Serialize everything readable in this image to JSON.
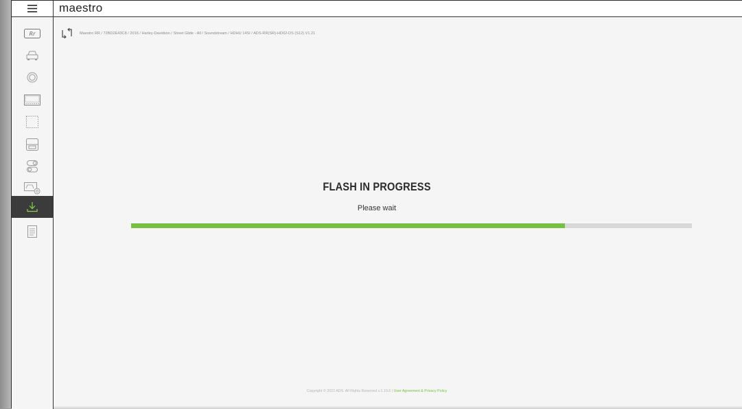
{
  "app": {
    "logo": "maestro"
  },
  "sidebar": {
    "items": [
      {
        "icon": "rr-logo-icon"
      },
      {
        "icon": "car-icon"
      },
      {
        "icon": "steering-wheel-icon"
      },
      {
        "icon": "radio-display-icon"
      },
      {
        "icon": "dashed-panel-icon"
      },
      {
        "icon": "instrument-panel-icon"
      },
      {
        "icon": "toggle-settings-icon"
      },
      {
        "icon": "vehicle-settings-icon"
      },
      {
        "icon": "download-flash-icon",
        "active": true
      },
      {
        "icon": "document-icon"
      }
    ]
  },
  "breadcrumb": {
    "text": "Maestro RR / 72BD2E43C8 / 2016 / Harley-Davidson / Street Glide - All / Soundstream / HDHU 14SI / ADS-RR(SR)-HD02-DS (S12) V1.21"
  },
  "main": {
    "title": "FLASH IN PROGRESS",
    "subtitle": "Please wait",
    "progress": 0.774
  },
  "footer": {
    "copyright": "Copyright © 2022 ADS. All Rights Reserved v.1.10.6 | ",
    "link": "User Agreement & Privacy Policy"
  },
  "colors": {
    "accent": "#78c043",
    "active_nav": "#3b3b3b",
    "track": "#d8d8d8"
  }
}
